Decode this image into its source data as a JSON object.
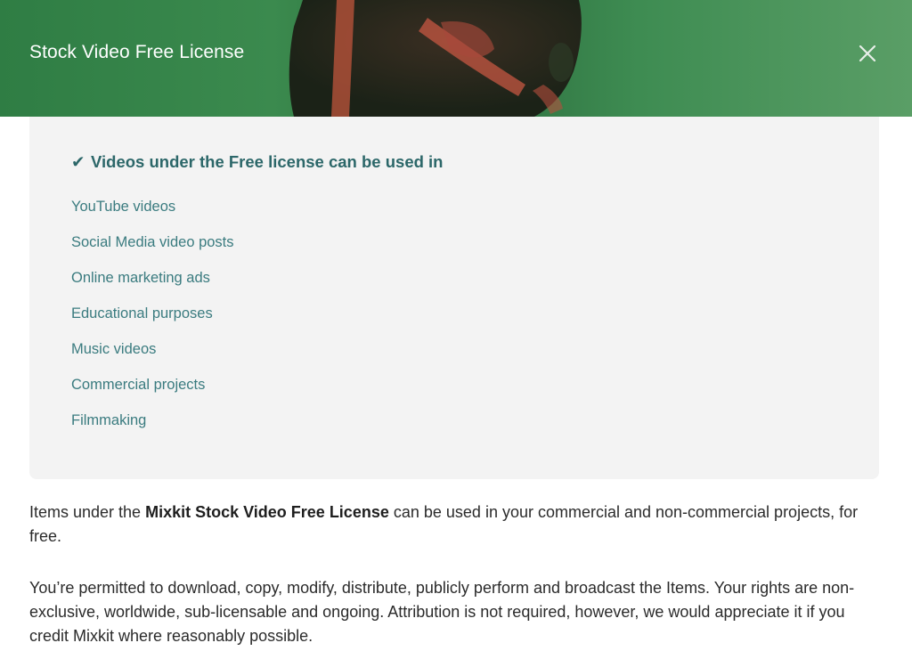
{
  "modal": {
    "title": "Stock Video Free License",
    "close_icon": "close-icon",
    "header_color": "#3b8a4e"
  },
  "panel": {
    "check_glyph": "✔",
    "heading": "Videos under the Free license can be used in",
    "items": [
      "YouTube videos",
      "Social Media video posts",
      "Online marketing ads",
      "Educational purposes",
      "Music videos",
      "Commercial projects",
      "Filmmaking"
    ],
    "text_color": "#2c6769"
  },
  "body": {
    "para1_prefix": "Items under the ",
    "para1_bold": "Mixkit Stock Video Free License",
    "para1_suffix": " can be used in your commercial and non-commercial projects, for free.",
    "para2": "You’re permitted to download, copy, modify, distribute, publicly perform and broadcast the Items. Your rights are non-exclusive, worldwide, sub-licensable and ongoing. Attribution is not required, however, we would appreciate it if you credit Mixkit where reasonably possible."
  }
}
